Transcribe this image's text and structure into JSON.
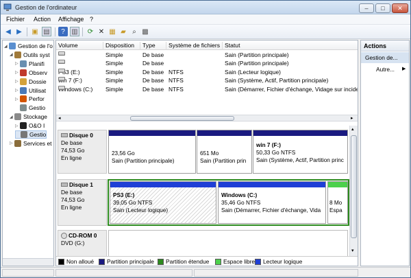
{
  "window": {
    "title": "Gestion de l'ordinateur"
  },
  "menu": [
    "Fichier",
    "Action",
    "Affichage",
    "?"
  ],
  "tree": [
    {
      "label": "Gestion de l'o",
      "indent": 0,
      "icon": "computer-management-icon"
    },
    {
      "label": "Outils syst",
      "indent": 1,
      "icon": "tools-icon"
    },
    {
      "label": "Planifi",
      "indent": 2,
      "icon": "clock-icon"
    },
    {
      "label": "Observ",
      "indent": 2,
      "icon": "event-viewer-icon"
    },
    {
      "label": "Dossie",
      "indent": 2,
      "icon": "shared-folder-icon"
    },
    {
      "label": "Utilisat",
      "indent": 2,
      "icon": "users-icon"
    },
    {
      "label": "Perfor",
      "indent": 2,
      "icon": "performance-icon"
    },
    {
      "label": "Gestio",
      "indent": 2,
      "icon": "device-manager-icon"
    },
    {
      "label": "Stockage",
      "indent": 1,
      "icon": "storage-icon"
    },
    {
      "label": "O&O I",
      "indent": 2,
      "icon": "oo-defrag-icon"
    },
    {
      "label": "Gestio",
      "indent": 2,
      "icon": "disk-management-icon"
    },
    {
      "label": "Services et",
      "indent": 1,
      "icon": "services-icon"
    }
  ],
  "volumes": {
    "headers": [
      "Volume",
      "Disposition",
      "Type",
      "Système de fichiers",
      "Statut"
    ],
    "rows": [
      {
        "volume": "",
        "disposition": "Simple",
        "type": "De base",
        "fs": "",
        "status": "Sain (Partition principale)"
      },
      {
        "volume": "",
        "disposition": "Simple",
        "type": "De base",
        "fs": "",
        "status": "Sain (Partition principale)"
      },
      {
        "volume": "PS3 (E:)",
        "disposition": "Simple",
        "type": "De base",
        "fs": "NTFS",
        "status": "Sain (Lecteur logique)"
      },
      {
        "volume": "win 7  (F:)",
        "disposition": "Simple",
        "type": "De base",
        "fs": "NTFS",
        "status": "Sain (Système, Actif, Partition principale)"
      },
      {
        "volume": "Windows (C:)",
        "disposition": "Simple",
        "type": "De base",
        "fs": "NTFS",
        "status": "Sain (Démarrer, Fichier d'échange, Vidage sur incide"
      }
    ]
  },
  "disks": [
    {
      "name": "Disque 0",
      "type": "De base",
      "size": "74,53 Go",
      "state": "En ligne",
      "partitions": [
        {
          "title": "",
          "size": "23,56 Go",
          "status": "Sain (Partition principale)"
        },
        {
          "title": "",
          "size": "651 Mo",
          "status": "Sain (Partition prin"
        },
        {
          "title": "win 7   (F:)",
          "size": "50,33 Go NTFS",
          "status": "Sain (Système, Actif, Partition princ"
        }
      ]
    },
    {
      "name": "Disque 1",
      "type": "De base",
      "size": "74,53 Go",
      "state": "En ligne",
      "partitions": [
        {
          "title": "PS3  (E:)",
          "size": "39,05 Go NTFS",
          "status": "Sain (Lecteur logique)"
        },
        {
          "title": "Windows  (C:)",
          "size": "35,46 Go NTFS",
          "status": "Sain (Démarrer, Fichier d'échange, Vida"
        },
        {
          "title": "",
          "size": "8 Mo",
          "status": "Espa"
        }
      ]
    },
    {
      "name": "CD-ROM 0",
      "type": "DVD (G:)",
      "size": "",
      "state": "",
      "partitions": []
    }
  ],
  "legend": [
    {
      "label": "Non alloué",
      "color": "#000000"
    },
    {
      "label": "Partition principale",
      "color": "#1a1a80"
    },
    {
      "label": "Partition étendue",
      "color": "#2c8a1e"
    },
    {
      "label": "Espace libre",
      "color": "#4cd04c"
    },
    {
      "label": "Lecteur logique",
      "color": "#1f3fd6"
    }
  ],
  "actions": {
    "header": "Actions",
    "item": "Gestion de...",
    "more": "Autre..."
  }
}
